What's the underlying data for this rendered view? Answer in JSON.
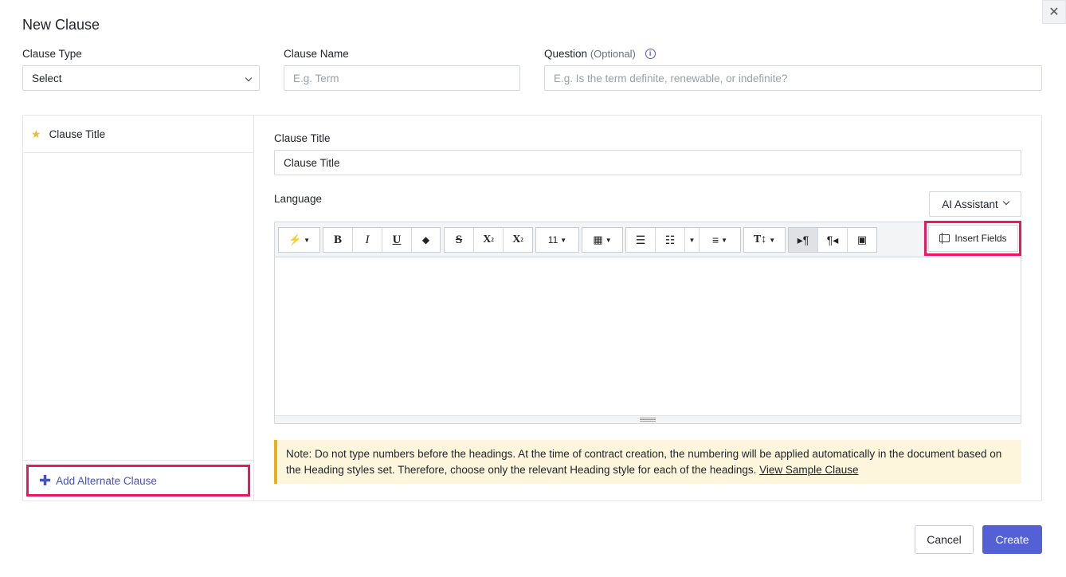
{
  "dialog": {
    "title": "New Clause",
    "close_symbol": "✕"
  },
  "form": {
    "clause_type_label": "Clause Type",
    "clause_type_value": "Select",
    "clause_name_label": "Clause Name",
    "clause_name_placeholder": "E.g. Term",
    "question_label": "Question",
    "question_optional": "(Optional)",
    "question_placeholder": "E.g. Is the term definite, renewable, or indefinite?"
  },
  "sidebar": {
    "items": [
      {
        "label": "Clause Title",
        "icon": "star-icon"
      }
    ],
    "add_alternate_label": "Add Alternate Clause"
  },
  "editor": {
    "clause_title_label": "Clause Title",
    "clause_title_value": "Clause Title",
    "language_label": "Language",
    "ai_assistant_label": "AI Assistant",
    "insert_fields_label": "Insert Fields",
    "font_size": "11"
  },
  "note": {
    "text": "Note: Do not type numbers before the headings. At the time of contract creation, the numbering will be applied automatically in the document based on the Heading styles set. Therefore, choose only the relevant Heading style for each of the headings.",
    "link": "View Sample Clause"
  },
  "footer": {
    "cancel_label": "Cancel",
    "create_label": "Create"
  },
  "colors": {
    "accent": "#5461d6",
    "highlight": "#e8195c",
    "note_bg": "#fdf6dd",
    "note_border": "#e8b020",
    "star": "#f1b92f"
  }
}
